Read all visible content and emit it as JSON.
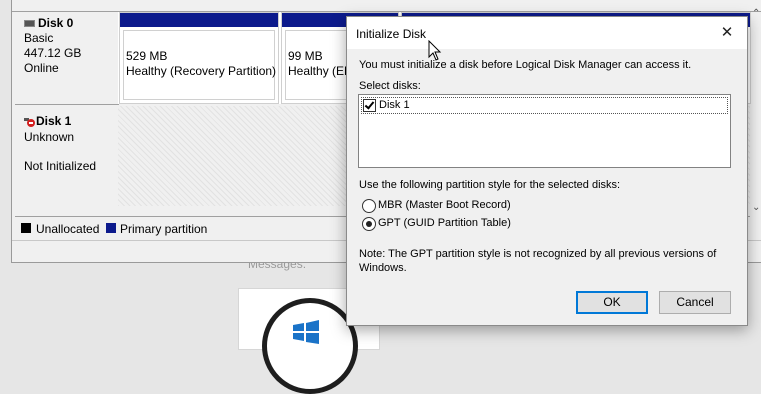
{
  "background": {
    "messages_label": "Messages:"
  },
  "disk_management": {
    "disk0": {
      "name": "Disk 0",
      "type": "Basic",
      "size": "447.12 GB",
      "status": "Online",
      "icon": "disk-icon"
    },
    "disk1": {
      "name": "Disk 1",
      "type": "Unknown",
      "status": "Not Initialized",
      "icon": "disk-error-icon"
    },
    "partitions": [
      {
        "size": "529 MB",
        "status": "Healthy (Recovery Partition)"
      },
      {
        "size": "99 MB",
        "status": "Healthy (EF"
      }
    ],
    "legend": [
      {
        "label": "Unallocated",
        "color": "#000000"
      },
      {
        "label": "Primary partition",
        "color": "#0c1a8c"
      }
    ]
  },
  "dialog": {
    "title": "Initialize Disk",
    "instruction": "You must initialize a disk before Logical Disk Manager can access it.",
    "select_disks_label": "Select disks:",
    "disks": [
      {
        "label": "Disk 1",
        "checked": true
      }
    ],
    "partition_style_label": "Use the following partition style for the selected disks:",
    "options": [
      {
        "label": "MBR (Master Boot Record)",
        "selected": false
      },
      {
        "label": "GPT (GUID Partition Table)",
        "selected": true
      }
    ],
    "note_line1": "Note: The GPT partition style is not recognized by all previous versions of",
    "note_line2": "Windows.",
    "ok_label": "OK",
    "cancel_label": "Cancel"
  },
  "colors": {
    "primary_partition": "#0c1a8c",
    "default_button_border": "#0078d7"
  }
}
